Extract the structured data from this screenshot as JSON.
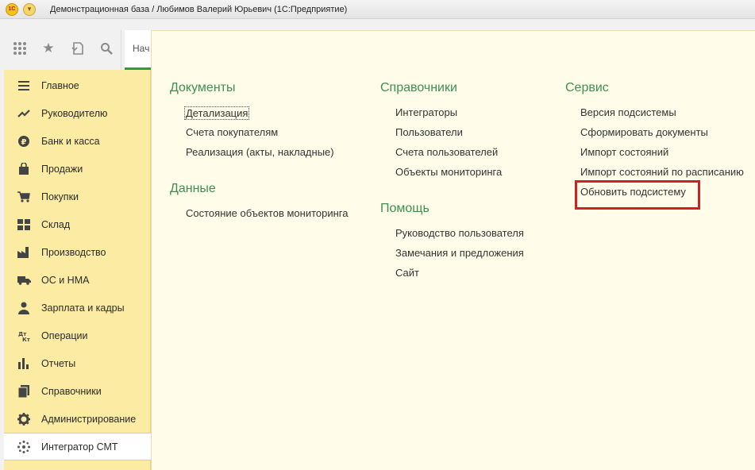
{
  "window": {
    "title": "Демонстрационная база / Любимов Валерий Юрьевич  (1С:Предприятие)",
    "logo_text": "1С"
  },
  "toolbar": {
    "tab_start_label": "Нач",
    "icons": [
      "grid-icon",
      "star-icon",
      "history-icon",
      "search-icon"
    ]
  },
  "sidebar": {
    "items": [
      {
        "label": "Главное",
        "icon": "menu-icon"
      },
      {
        "label": "Руководителю",
        "icon": "trend-icon"
      },
      {
        "label": "Банк и касса",
        "icon": "coin-icon"
      },
      {
        "label": "Продажи",
        "icon": "bag-icon"
      },
      {
        "label": "Покупки",
        "icon": "cart-icon"
      },
      {
        "label": "Склад",
        "icon": "warehouse-icon"
      },
      {
        "label": "Производство",
        "icon": "factory-icon"
      },
      {
        "label": "ОС и НМА",
        "icon": "truck-icon"
      },
      {
        "label": "Зарплата и кадры",
        "icon": "person-icon"
      },
      {
        "label": "Операции",
        "icon": "dt-kt-icon"
      },
      {
        "label": "Отчеты",
        "icon": "bar-chart-icon"
      },
      {
        "label": "Справочники",
        "icon": "book-icon"
      },
      {
        "label": "Администрирование",
        "icon": "gear-icon"
      },
      {
        "label": "Интегратор СМТ",
        "icon": "network-icon",
        "active": true
      }
    ]
  },
  "content": {
    "columns": [
      {
        "sections": [
          {
            "title": "Документы",
            "links": [
              "Детализация",
              "Счета покупателям",
              "Реализация (акты, накладные)"
            ]
          },
          {
            "title": "Данные",
            "links": [
              "Состояние объектов мониторинга"
            ]
          }
        ]
      },
      {
        "sections": [
          {
            "title": "Справочники",
            "links": [
              "Интеграторы",
              "Пользователи",
              "Счета пользователей",
              "Объекты мониторинга"
            ]
          },
          {
            "title": "Помощь",
            "links": [
              "Руководство пользователя",
              "Замечания и предложения",
              "Сайт"
            ]
          }
        ]
      },
      {
        "sections": [
          {
            "title": "Сервис",
            "links": [
              "Версия подсистемы",
              "Сформировать документы",
              "Импорт состояний",
              "Импорт состояний по расписанию",
              "Обновить подсистему"
            ]
          }
        ]
      }
    ]
  },
  "colors": {
    "section_title": "#3e8f52",
    "sidebar_bg": "#fbeba3",
    "content_bg": "#fffde9",
    "highlight": "#d21f1f",
    "tab_accent": "#22a33a"
  }
}
